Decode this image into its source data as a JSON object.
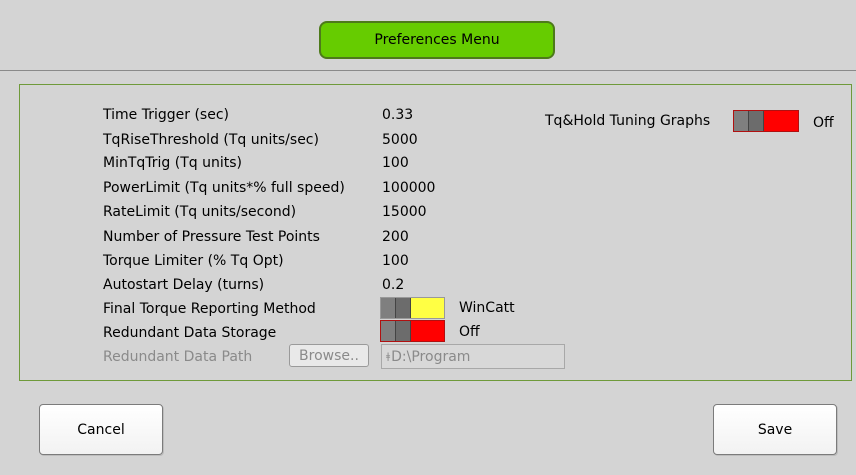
{
  "header": {
    "title": "Preferences Menu"
  },
  "settings": {
    "time_trigger": {
      "label": "Time Trigger (sec)",
      "value": "0.33"
    },
    "tq_rise": {
      "label": "TqRiseThreshold (Tq units/sec)",
      "value": "5000"
    },
    "min_tq_trig": {
      "label": "MinTqTrig (Tq units)",
      "value": "100"
    },
    "power_limit": {
      "label": "PowerLimit (Tq units*% full speed)",
      "value": "100000"
    },
    "rate_limit": {
      "label": "RateLimit (Tq units/second)",
      "value": "15000"
    },
    "pressure_points": {
      "label": "Number of Pressure Test Points",
      "value": "200"
    },
    "torque_limiter": {
      "label": "Torque Limiter (% Tq Opt)",
      "value": "100"
    },
    "autostart_delay": {
      "label": "Autostart Delay (turns)",
      "value": "0.2"
    },
    "final_torque": {
      "label": "Final Torque Reporting Method",
      "state": "WinCatt",
      "color": "#ffff44"
    },
    "redundant_storage": {
      "label": "Redundant Data Storage",
      "state": "Off",
      "color": "#ff0000"
    },
    "redundant_path": {
      "label": "Redundant Data Path",
      "browse_label": "Browse..",
      "path_prefix": "ǂ",
      "path_value": "D:\\Program"
    },
    "tq_hold_graphs": {
      "label": "Tq&Hold Tuning Graphs",
      "state": "Off",
      "color": "#ff0000"
    }
  },
  "footer": {
    "cancel_label": "Cancel",
    "save_label": "Save"
  },
  "colors": {
    "accent_green": "#66cc00",
    "panel_border": "#6f9a3a"
  }
}
